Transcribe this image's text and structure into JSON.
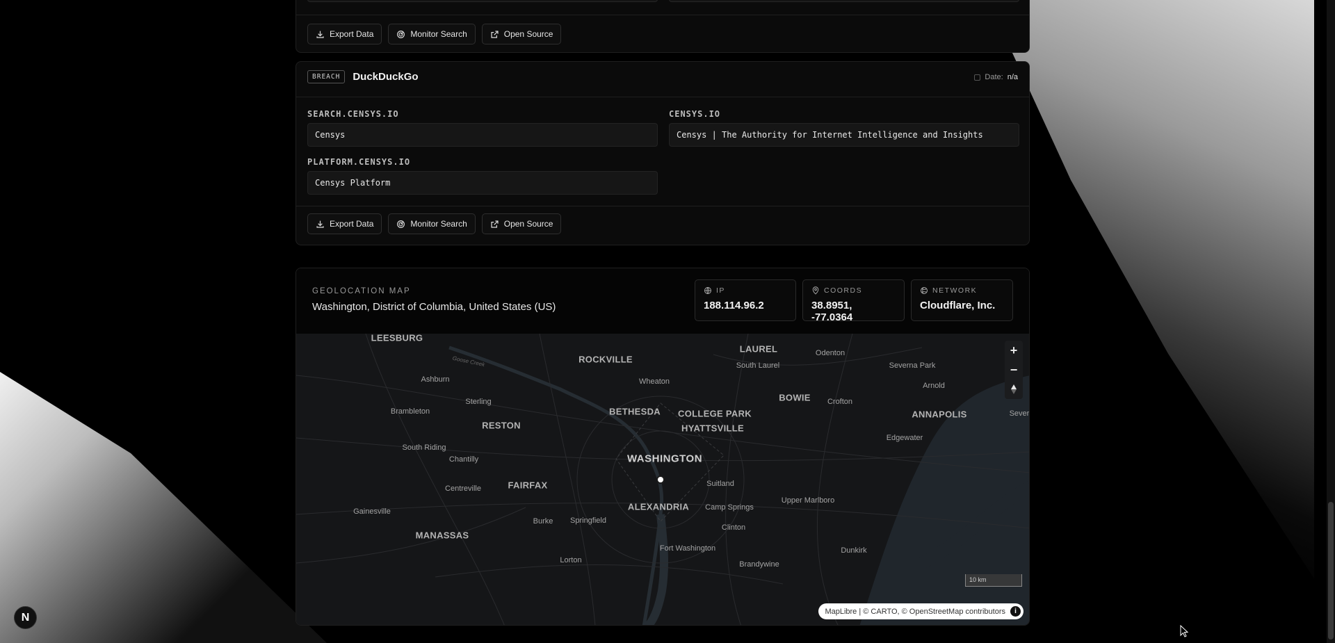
{
  "actions": {
    "export_label": "Export Data",
    "monitor_label": "Monitor Search",
    "open_label": "Open Source"
  },
  "breach": {
    "badge": "BREACH",
    "title": "DuckDuckGo",
    "date_label": "Date:",
    "date_value": "n/a",
    "fields": [
      {
        "label": "SEARCH.CENSYS.IO",
        "value": "Censys"
      },
      {
        "label": "CENSYS.IO",
        "value": "Censys | The Authority for Internet Intelligence and Insights"
      },
      {
        "label": "PLATFORM.CENSYS.IO",
        "value": "Censys Platform"
      }
    ]
  },
  "geo": {
    "heading": "GEOLOCATION MAP",
    "location": "Washington, District of Columbia, United States (US)",
    "ip_label": "IP",
    "ip_value": "188.114.96.2",
    "coords_label": "COORDS",
    "coords_value": "38.8951, -77.0364",
    "network_label": "NETWORK",
    "network_value": "Cloudflare, Inc."
  },
  "map": {
    "places": {
      "leesburg": "LEESBURG",
      "rockville": "ROCKVILLE",
      "laurel": "LAUREL",
      "odenton": "Odenton",
      "south_laurel": "South Laurel",
      "severna_park": "Severna Park",
      "ashburn": "Ashburn",
      "wheaton": "Wheaton",
      "arnold": "Arnold",
      "sterling": "Sterling",
      "bowie": "BOWIE",
      "crofton": "Crofton",
      "brambleton": "Brambleton",
      "bethesda": "BETHESDA",
      "college_park": "COLLEGE PARK",
      "annapolis": "ANNAPOLIS",
      "severn": "Severn",
      "reston": "RESTON",
      "hyattsville": "HYATTSVILLE",
      "edgewater": "Edgewater",
      "south_riding": "South Riding",
      "chantilly": "Chantilly",
      "washington": "WASHINGTON",
      "fairfax": "FAIRFAX",
      "centreville": "Centreville",
      "suitland": "Suitland",
      "upper_marlboro": "Upper Marlboro",
      "alexandria": "ALEXANDRIA",
      "camp_springs": "Camp Springs",
      "gainesville": "Gainesville",
      "burke": "Burke",
      "springfield": "Springfield",
      "clinton": "Clinton",
      "manassas": "MANASSAS",
      "fort_washington": "Fort Washington",
      "dunkirk": "Dunkirk",
      "lorton": "Lorton",
      "brandywine": "Brandywine",
      "creek": "Goose Creek"
    },
    "scale_label": "10 km",
    "attribution": "MapLibre | © CARTO, © OpenStreetMap contributors",
    "zoom_in": "+",
    "zoom_out": "−"
  },
  "nav_badge": "N"
}
